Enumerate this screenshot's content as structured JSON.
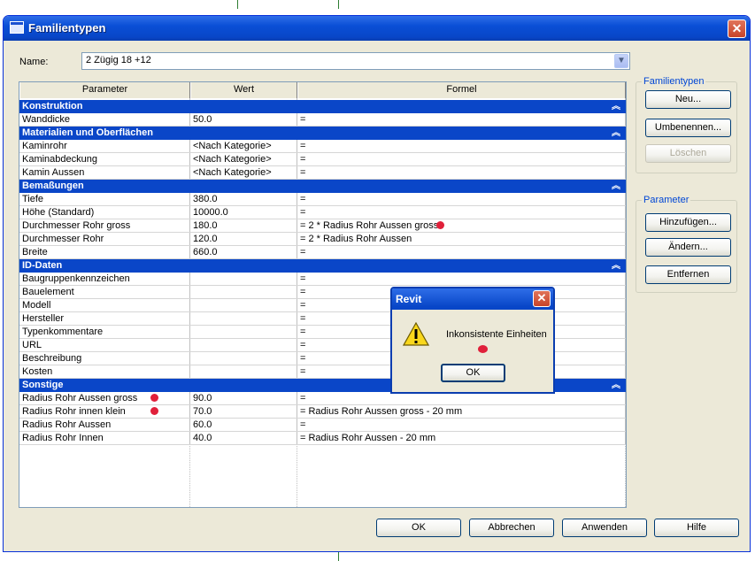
{
  "window": {
    "title": "Familientypen",
    "close_label": "✕"
  },
  "name_field": {
    "label": "Name:",
    "value": "2 Zügig 18 +12"
  },
  "table": {
    "headers": [
      "Parameter",
      "Wert",
      "Formel"
    ],
    "groups": [
      {
        "title": "Konstruktion",
        "rows": [
          {
            "param": "Wanddicke",
            "value": "50.0",
            "formula": "=",
            "param_marker": false,
            "formula_marker": false
          }
        ]
      },
      {
        "title": "Materialien und Oberflächen",
        "rows": [
          {
            "param": "Kaminrohr",
            "value": "<Nach Kategorie>",
            "formula": "=",
            "param_marker": false,
            "formula_marker": false
          },
          {
            "param": "Kaminabdeckung",
            "value": "<Nach Kategorie>",
            "formula": "=",
            "param_marker": false,
            "formula_marker": false
          },
          {
            "param": "Kamin Aussen",
            "value": "<Nach Kategorie>",
            "formula": "=",
            "param_marker": false,
            "formula_marker": false
          }
        ]
      },
      {
        "title": "Bemaßungen",
        "rows": [
          {
            "param": "Tiefe",
            "value": "380.0",
            "formula": "=",
            "param_marker": false,
            "formula_marker": false
          },
          {
            "param": "Höhe (Standard)",
            "value": "10000.0",
            "formula": "=",
            "param_marker": false,
            "formula_marker": false
          },
          {
            "param": "Durchmesser Rohr gross",
            "value": "180.0",
            "formula": "= 2 * Radius Rohr Aussen gross",
            "param_marker": false,
            "formula_marker": true
          },
          {
            "param": "Durchmesser Rohr",
            "value": "120.0",
            "formula": "= 2 * Radius Rohr Aussen",
            "param_marker": false,
            "formula_marker": false
          },
          {
            "param": "Breite",
            "value": "660.0",
            "formula": "=",
            "param_marker": false,
            "formula_marker": false
          }
        ]
      },
      {
        "title": "ID-Daten",
        "rows": [
          {
            "param": "Baugruppenkennzeichen",
            "value": "",
            "formula": "=",
            "param_marker": false,
            "formula_marker": false
          },
          {
            "param": "Bauelement",
            "value": "",
            "formula": "=",
            "param_marker": false,
            "formula_marker": false
          },
          {
            "param": "Modell",
            "value": "",
            "formula": "=",
            "param_marker": false,
            "formula_marker": false
          },
          {
            "param": "Hersteller",
            "value": "",
            "formula": "=",
            "param_marker": false,
            "formula_marker": false
          },
          {
            "param": "Typenkommentare",
            "value": "",
            "formula": "=",
            "param_marker": false,
            "formula_marker": false
          },
          {
            "param": "URL",
            "value": "",
            "formula": "=",
            "param_marker": false,
            "formula_marker": false
          },
          {
            "param": "Beschreibung",
            "value": "",
            "formula": "=",
            "param_marker": false,
            "formula_marker": false
          },
          {
            "param": "Kosten",
            "value": "",
            "formula": "=",
            "param_marker": false,
            "formula_marker": false
          }
        ]
      },
      {
        "title": "Sonstige",
        "rows": [
          {
            "param": "Radius Rohr Aussen gross",
            "value": "90.0",
            "formula": "=",
            "param_marker": true,
            "formula_marker": false
          },
          {
            "param": "Radius Rohr innen klein",
            "value": "70.0",
            "formula": "= Radius Rohr Aussen gross - 20 mm",
            "param_marker": true,
            "formula_marker": false
          },
          {
            "param": "Radius Rohr Aussen",
            "value": "60.0",
            "formula": "=",
            "param_marker": false,
            "formula_marker": false
          },
          {
            "param": "Radius Rohr Innen",
            "value": "40.0",
            "formula": "= Radius Rohr Aussen - 20 mm",
            "param_marker": false,
            "formula_marker": false
          }
        ]
      }
    ]
  },
  "familientypen_panel": {
    "legend": "Familientypen",
    "new_label": "Neu...",
    "rename_label": "Umbenennen...",
    "delete_label": "Löschen"
  },
  "parameter_panel": {
    "legend": "Parameter",
    "add_label": "Hinzufügen...",
    "edit_label": "Ändern...",
    "remove_label": "Entfernen"
  },
  "footer": {
    "ok_label": "OK",
    "cancel_label": "Abbrechen",
    "apply_label": "Anwenden",
    "help_label": "Hilfe"
  },
  "alert": {
    "title": "Revit",
    "message": "Inkonsistente Einheiten",
    "ok_label": "OK",
    "close_label": "✕",
    "icon": "warning-icon"
  },
  "colors": {
    "group_header": "#0a46c8",
    "marker": "#e0203a",
    "title_bar": "#0a4fd6"
  }
}
